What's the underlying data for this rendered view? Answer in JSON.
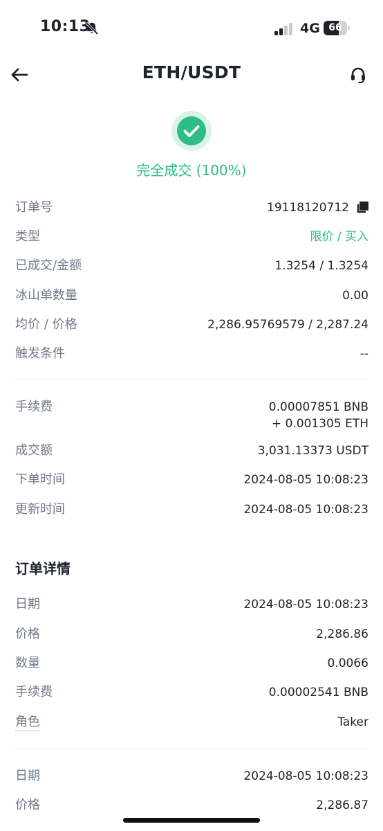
{
  "status_bar": {
    "time": "10:13",
    "network": "4G",
    "battery_level": "66",
    "battery_fraction": 0.66,
    "icons": [
      "bell-muted-icon",
      "signal-icon"
    ]
  },
  "nav": {
    "title": "ETH/USDT",
    "back_icon": "arrow-left-icon",
    "support_icon": "headset-icon"
  },
  "order_status": {
    "icon": "check-circle-icon",
    "text": "完全成交 (100%)",
    "color": "#2ebd85"
  },
  "summary": [
    {
      "label": "订单号",
      "value": "19118120712",
      "icon": "copy-icon"
    },
    {
      "label": "类型",
      "value": "限价 / 买入",
      "accent": "#2ebd85"
    },
    {
      "label": "已成交/金额",
      "value": "1.3254 / 1.3254"
    },
    {
      "label": "冰山单数量",
      "value": "0.00"
    },
    {
      "label": "均价 / 价格",
      "value": "2,286.95769579 / 2,287.24"
    },
    {
      "label": "触发条件",
      "value": "--"
    }
  ],
  "fees": [
    {
      "label": "手续费",
      "value_lines": [
        "0.00007851 BNB",
        "+ 0.001305 ETH"
      ]
    },
    {
      "label": "成交额",
      "value": "3,031.13373 USDT"
    },
    {
      "label": "下单时间",
      "value": "2024-08-05 10:08:23"
    },
    {
      "label": "更新时间",
      "value": "2024-08-05 10:08:23"
    }
  ],
  "details": {
    "title": "订单详情",
    "fills": [
      {
        "rows": [
          {
            "label": "日期",
            "value": "2024-08-05 10:08:23"
          },
          {
            "label": "价格",
            "value": "2,286.86"
          },
          {
            "label": "数量",
            "value": "0.0066"
          },
          {
            "label": "手续费",
            "value": "0.00002541 BNB"
          },
          {
            "label": "角色",
            "value": "Taker"
          }
        ]
      },
      {
        "rows": [
          {
            "label": "日期",
            "value": "2024-08-05 10:08:23"
          },
          {
            "label": "价格",
            "value": "2,286.87"
          }
        ]
      }
    ]
  }
}
